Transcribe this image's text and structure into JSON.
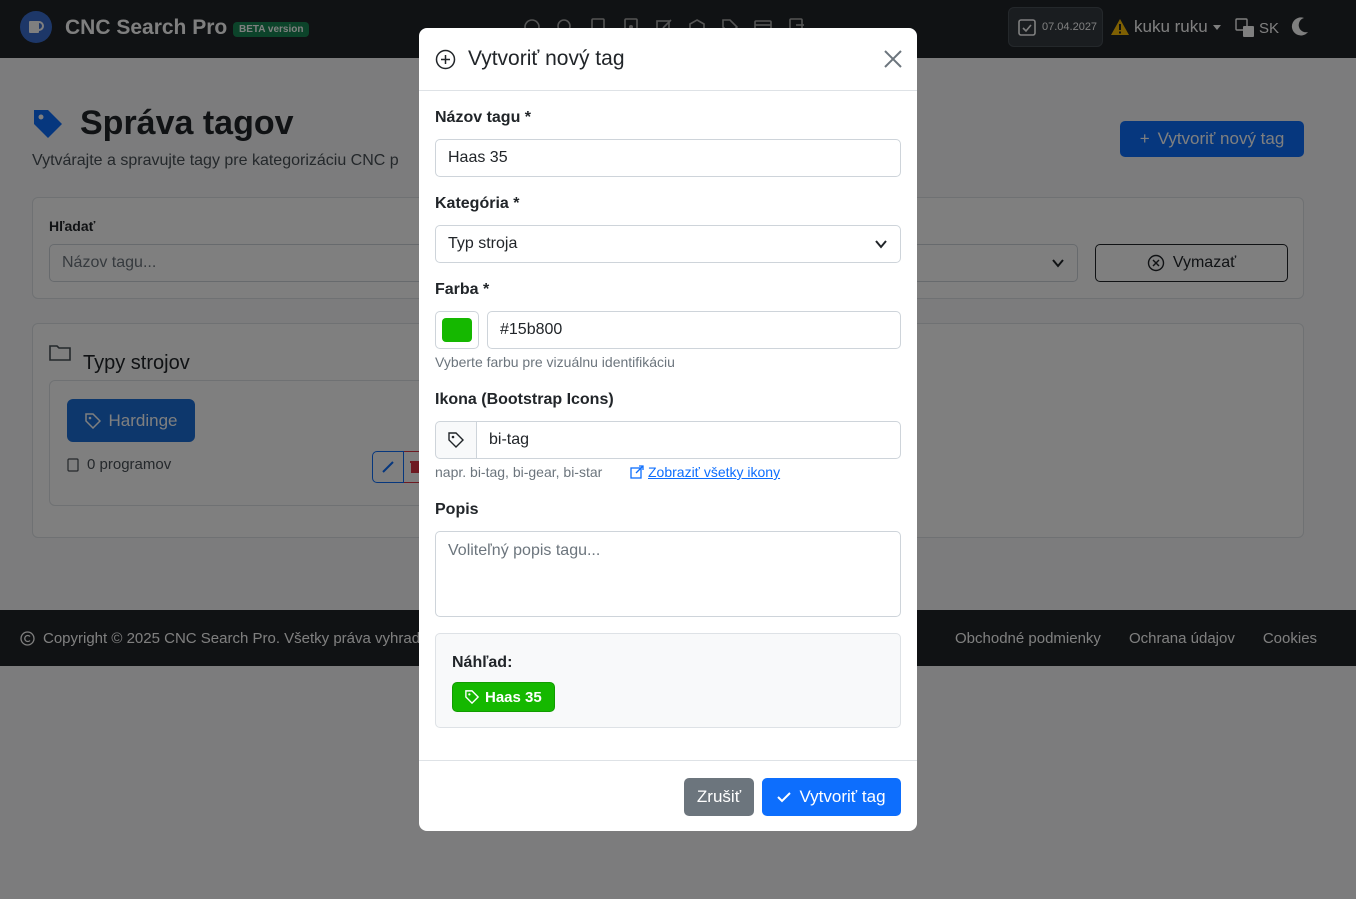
{
  "navbar": {
    "brand": "CNC Search Pro",
    "beta": "BETA version",
    "date": "07.04.2027",
    "user": "kuku ruku",
    "lang": "SK",
    "icons": [
      "dashboard-icon",
      "search-icon",
      "file-icon",
      "file-image-icon",
      "pencil-square-icon",
      "box-icon",
      "tags-icon",
      "card-icon",
      "file-export-icon"
    ]
  },
  "page": {
    "title": "Správa tagov",
    "subtitle": "Vytvárajte a spravujte tagy pre kategorizáciu CNC p",
    "create_button": "Vytvoriť nový tag",
    "search": {
      "label": "Hľadať",
      "placeholder": "Názov tagu...",
      "clear_button": "Vymazať"
    },
    "types": {
      "title": "Typy strojov",
      "tag_name": "Hardinge",
      "programs": "0 programov"
    }
  },
  "footer": {
    "copyright": "Copyright © 2025 CNC Search Pro. Všetky práva vyhrad",
    "links": [
      "Obchodné podmienky",
      "Ochrana údajov",
      "Cookies"
    ]
  },
  "modal": {
    "title": "Vytvoriť nový tag",
    "name_label": "Názov tagu *",
    "name_value": "Haas 35",
    "category_label": "Kategória *",
    "category_value": "Typ stroja",
    "color_label": "Farba *",
    "color_value": "#15b800",
    "color_help": "Vyberte farbu pre vizuálnu identifikáciu",
    "icon_label": "Ikona (Bootstrap Icons)",
    "icon_value": "bi-tag",
    "icon_help": "napr. bi-tag, bi-gear, bi-star",
    "icon_link": "Zobraziť všetky ikony",
    "desc_label": "Popis",
    "desc_placeholder": "Voliteľný popis tagu...",
    "preview_label": "Náhľad:",
    "preview_badge": "Haas 35",
    "cancel_button": "Zrušiť",
    "submit_button": "Vytvoriť tag"
  },
  "colors": {
    "primary": "#0d6efd",
    "tag_green": "#15b800",
    "dark": "#212529"
  }
}
